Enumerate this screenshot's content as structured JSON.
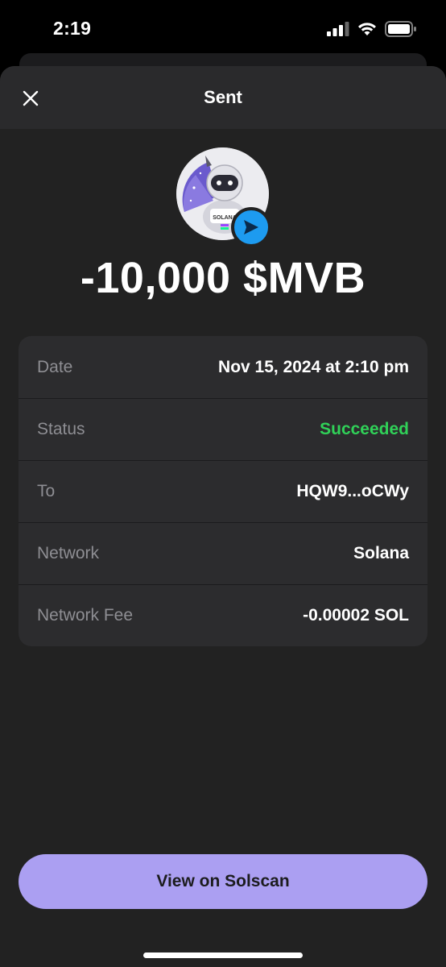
{
  "status_bar": {
    "time": "2:19"
  },
  "header": {
    "title": "Sent"
  },
  "token": {
    "logo_icon": "astronaut-token-icon",
    "badge_icon": "send-arrow-icon",
    "logo_text": "SOLANA"
  },
  "amount": "-10,000 $MVB",
  "details": [
    {
      "label": "Date",
      "value": "Nov 15, 2024 at 2:10 pm"
    },
    {
      "label": "Status",
      "value": "Succeeded"
    },
    {
      "label": "To",
      "value": "HQW9...oCWy"
    },
    {
      "label": "Network",
      "value": "Solana"
    },
    {
      "label": "Network Fee",
      "value": "-0.00002 SOL"
    }
  ],
  "actions": {
    "view_label": "View on Solscan"
  },
  "colors": {
    "accent": "#ab9ff2",
    "success": "#30d158",
    "badge": "#1d9bf0",
    "background": "#222222"
  }
}
